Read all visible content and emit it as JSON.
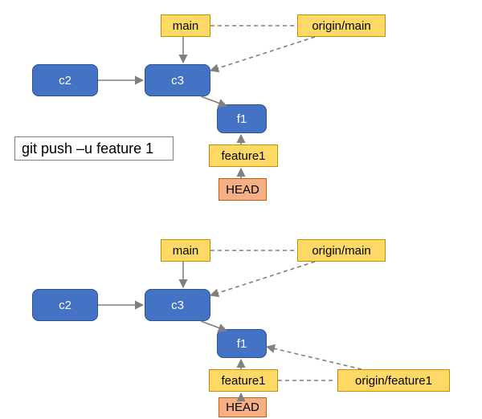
{
  "command": "git push –u feature 1",
  "before": {
    "commits": {
      "c2": "c2",
      "c3": "c3",
      "f1": "f1"
    },
    "branches": {
      "main": "main",
      "origin_main": "origin/main",
      "feature1": "feature1",
      "head": "HEAD"
    }
  },
  "after": {
    "commits": {
      "c2": "c2",
      "c3": "c3",
      "f1": "f1"
    },
    "branches": {
      "main": "main",
      "origin_main": "origin/main",
      "feature1": "feature1",
      "origin_feature1": "origin/feature1",
      "head": "HEAD"
    }
  },
  "colors": {
    "commit_bg": "#4472c4",
    "branch_bg": "#ffd966",
    "head_bg": "#f4b084",
    "arrow": "#808080"
  }
}
